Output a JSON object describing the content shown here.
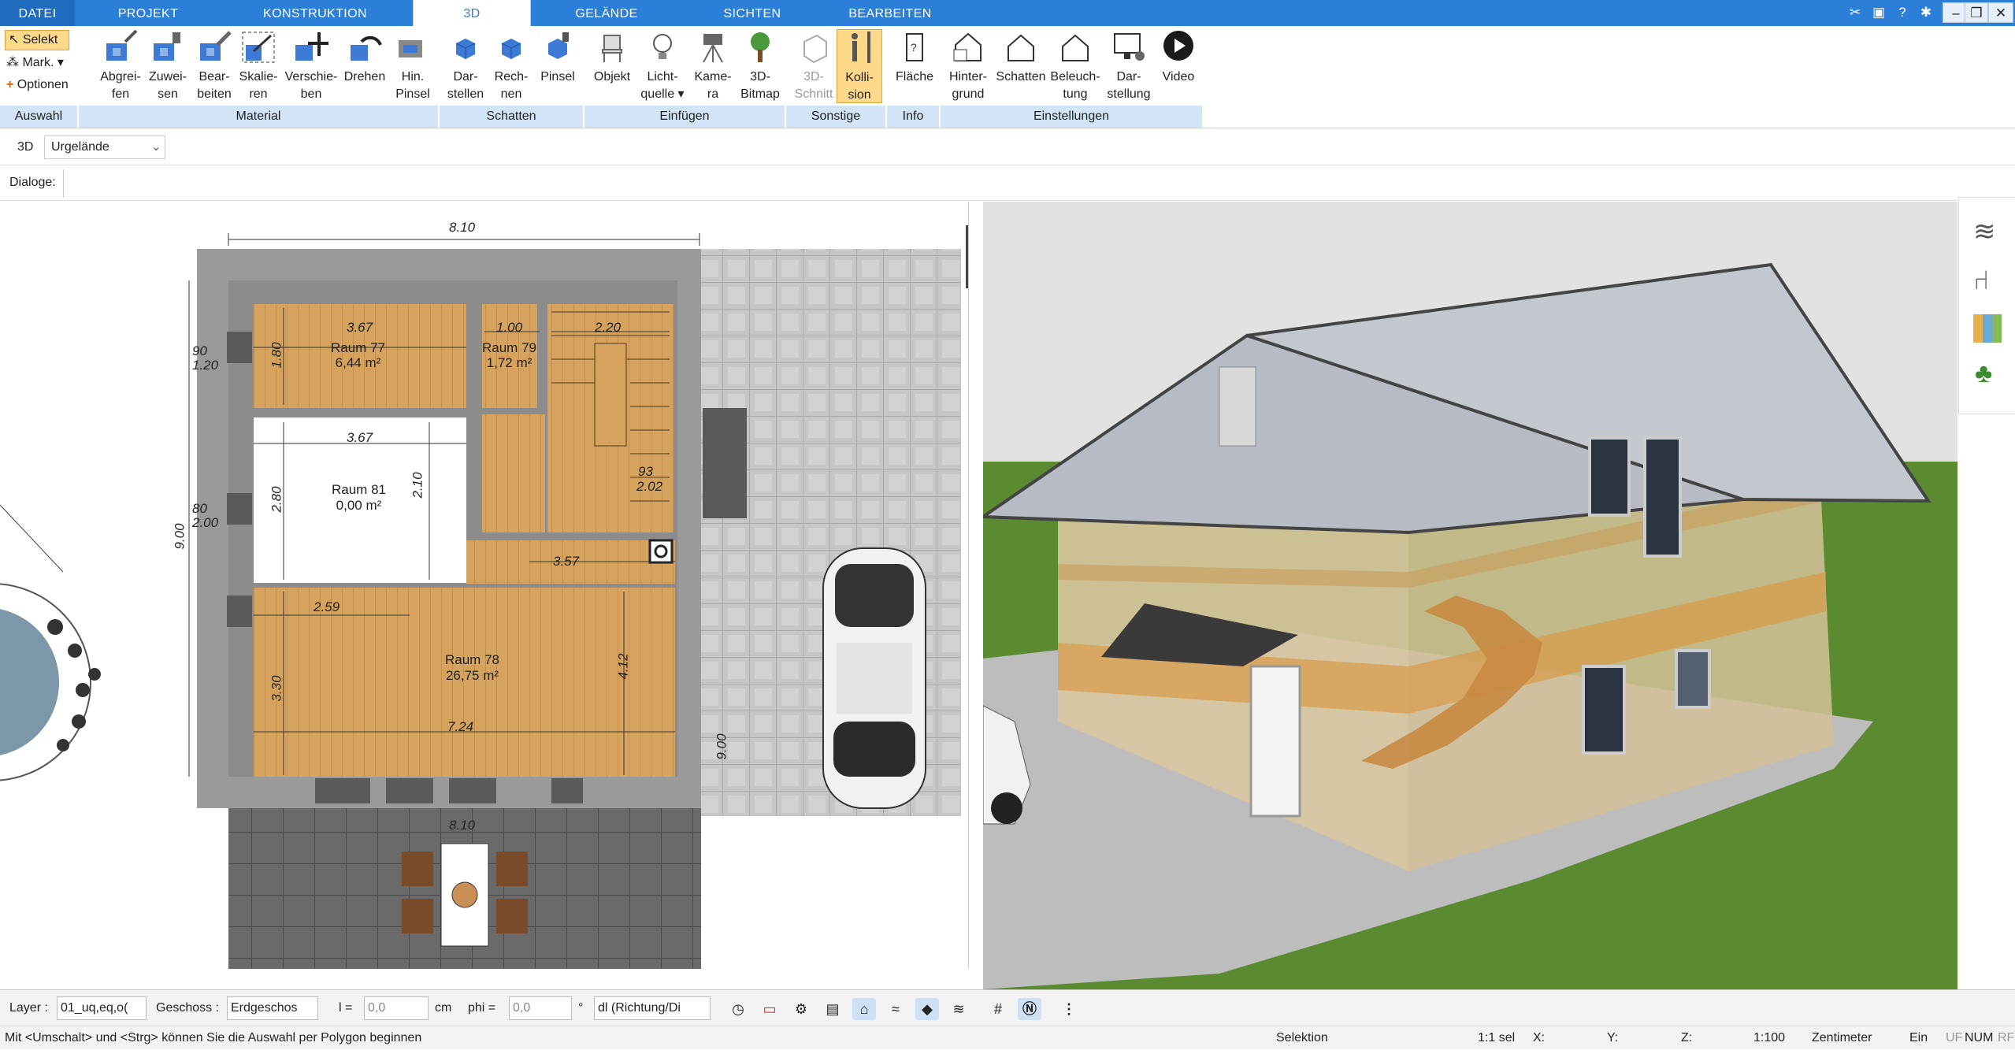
{
  "menu": {
    "tabs": [
      "DATEI",
      "PROJEKT",
      "KONSTRUKTION",
      "3D",
      "GELÄNDE",
      "SICHTEN",
      "BEARBEITEN"
    ],
    "active": "3D"
  },
  "ribbon": {
    "auswahl": {
      "selekt": "Selekt",
      "mark": "Mark.",
      "optionen": "Optionen",
      "group": "Auswahl"
    },
    "material": {
      "group": "Material",
      "buttons": [
        {
          "l1": "Abgrei-",
          "l2": "fen"
        },
        {
          "l1": "Zuwei-",
          "l2": "sen"
        },
        {
          "l1": "Bear-",
          "l2": "beiten"
        },
        {
          "l1": "Skalie-",
          "l2": "ren"
        },
        {
          "l1": "Verschie-",
          "l2": "ben"
        },
        {
          "l1": "Drehen",
          "l2": ""
        },
        {
          "l1": "Hin.",
          "l2": "Pinsel"
        }
      ]
    },
    "schatten": {
      "group": "Schatten",
      "buttons": [
        {
          "l1": "Dar-",
          "l2": "stellen"
        },
        {
          "l1": "Rech-",
          "l2": "nen"
        },
        {
          "l1": "Pinsel",
          "l2": ""
        }
      ]
    },
    "einfuegen": {
      "group": "Einfügen",
      "buttons": [
        {
          "l1": "Objekt",
          "l2": ""
        },
        {
          "l1": "Licht-",
          "l2": "quelle ▾"
        },
        {
          "l1": "Kame-",
          "l2": "ra"
        },
        {
          "l1": "3D-",
          "l2": "Bitmap"
        }
      ]
    },
    "sonstige": {
      "group": "Sonstige",
      "buttons": [
        {
          "l1": "3D-",
          "l2": "Schnitt"
        },
        {
          "l1": "Kolli-",
          "l2": "sion"
        }
      ]
    },
    "info": {
      "group": "Info",
      "buttons": [
        {
          "l1": "Fläche",
          "l2": ""
        }
      ]
    },
    "einstellungen": {
      "group": "Einstellungen",
      "buttons": [
        {
          "l1": "Hinter-",
          "l2": "grund"
        },
        {
          "l1": "Schatten",
          "l2": ""
        },
        {
          "l1": "Beleuch-",
          "l2": "tung"
        },
        {
          "l1": "Dar-",
          "l2": "stellung"
        },
        {
          "l1": "Video",
          "l2": ""
        }
      ]
    }
  },
  "subbar": {
    "mode": "3D",
    "terrain": "Urgelände"
  },
  "dialoge": "Dialoge:",
  "plan": {
    "dims": {
      "top": "8.10",
      "left": "9.00",
      "bottom": "8.10",
      "r77w": "3.67",
      "r81w": "3.67",
      "r78w": "2.59",
      "r78w2": "7.24",
      "h180": "1.80",
      "h280": "2.80",
      "h330": "3.30",
      "h412": "4.12",
      "h210": "2.10",
      "d357": "3.57",
      "d220": "2.20",
      "d100": "1.00",
      "d120": "1.20",
      "d90": "90",
      "d80": "80",
      "d200": "2.00",
      "d900": "9.00",
      "d93": "93",
      "d202": "2.02"
    },
    "rooms": [
      {
        "name": "Raum 77",
        "area": "6,44 m²"
      },
      {
        "name": "Raum 79",
        "area": "1,72 m²"
      },
      {
        "name": "Raum 81",
        "area": "0,00 m²"
      },
      {
        "name": "Raum 78",
        "area": "26,75 m²"
      }
    ]
  },
  "bottombar": {
    "layer_label": "Layer :",
    "layer_value": "01_uq,eq,o(",
    "geschoss_label": "Geschoss :",
    "geschoss_value": "Erdgeschos",
    "l_label": "l =",
    "l_value": "0,0",
    "l_unit": "cm",
    "phi_label": "phi =",
    "phi_value": "0,0",
    "phi_unit": "°",
    "dl_value": "dl (Richtung/Di"
  },
  "status": {
    "hint": "Mit <Umschalt> und <Strg> können Sie die Auswahl per Polygon beginnen",
    "mode": "Selektion",
    "sel": "1:1 sel",
    "x": "X:",
    "y": "Y:",
    "z": "Z:",
    "scale": "1:100",
    "unit": "Zentimeter",
    "ein": "Ein",
    "uf": "UF",
    "num": "NUM",
    "rf": "RF"
  },
  "colors": {
    "accent": "#2b7fd8",
    "groupbar": "#d3e4f7",
    "wood": "#d7a25d",
    "grass": "#5b8a30",
    "paving": "#b9b9b9"
  }
}
